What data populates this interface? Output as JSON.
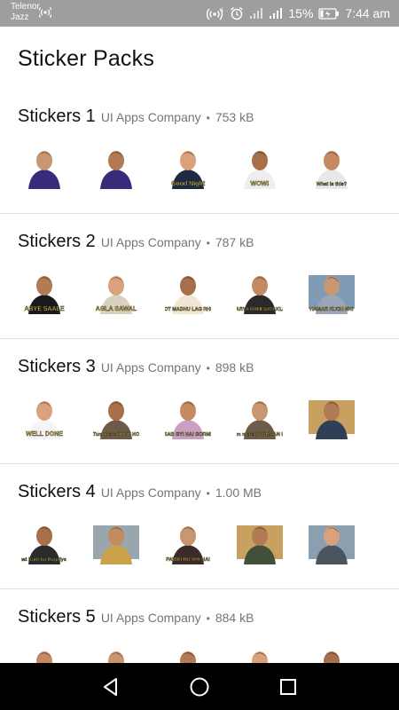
{
  "status_bar": {
    "carrier_line1": "Telenor",
    "carrier_line2": "Jazz",
    "battery_percent": "15%",
    "time": "7:44 am"
  },
  "header": {
    "title": "Sticker Packs"
  },
  "packs": [
    {
      "name": "Stickers 1",
      "publisher": "UI Apps Company",
      "separator": "•",
      "size": "753 kB",
      "stickers": [
        {
          "caption": ""
        },
        {
          "caption": ""
        },
        {
          "caption": "Good Night"
        },
        {
          "caption": "WOW!"
        },
        {
          "caption": "What is this?"
        }
      ]
    },
    {
      "name": "Stickers 2",
      "publisher": "UI Apps Company",
      "separator": "•",
      "size": "787 kB",
      "stickers": [
        {
          "caption": "ABYE SAALE"
        },
        {
          "caption": "AGLA SAWAL"
        },
        {
          "caption": "BAHOT MADHU LAG RHE HO"
        },
        {
          "caption": "ARYA RAHI SATAKLI"
        },
        {
          "caption": "HAMAR KUCH NHI"
        }
      ]
    },
    {
      "name": "Stickers 3",
      "publisher": "UI Apps Company",
      "separator": "•",
      "size": "898 kB",
      "stickers": [
        {
          "caption": "WELL DONE"
        },
        {
          "caption": "Tum mere DOST HO"
        },
        {
          "caption": "YE SAB GYI HAI GORMENT"
        },
        {
          "caption": "Tum mere DUSHMAN HO"
        },
        {
          "caption": ""
        }
      ]
    },
    {
      "name": "Stickers 4",
      "publisher": "UI Apps Company",
      "separator": "•",
      "size": "1.00 MB",
      "stickers": [
        {
          "caption": "Bohat Kadi tui Ragaiye bro"
        },
        {
          "caption": ""
        },
        {
          "caption": "PAWRI HO RHI HAI"
        },
        {
          "caption": ""
        },
        {
          "caption": ""
        }
      ]
    },
    {
      "name": "Stickers 5",
      "publisher": "UI Apps Company",
      "separator": "•",
      "size": "884 kB",
      "stickers": [
        {
          "caption": ""
        },
        {
          "caption": ""
        },
        {
          "caption": ""
        },
        {
          "caption": ""
        },
        {
          "caption": ""
        }
      ]
    }
  ],
  "colors": {
    "status_bar_bg": "#9e9e9e",
    "nav_bar_bg": "#000000",
    "divider": "#e0e0e0",
    "meta_text": "#757575",
    "caption_yellow": "#ffe14d"
  }
}
